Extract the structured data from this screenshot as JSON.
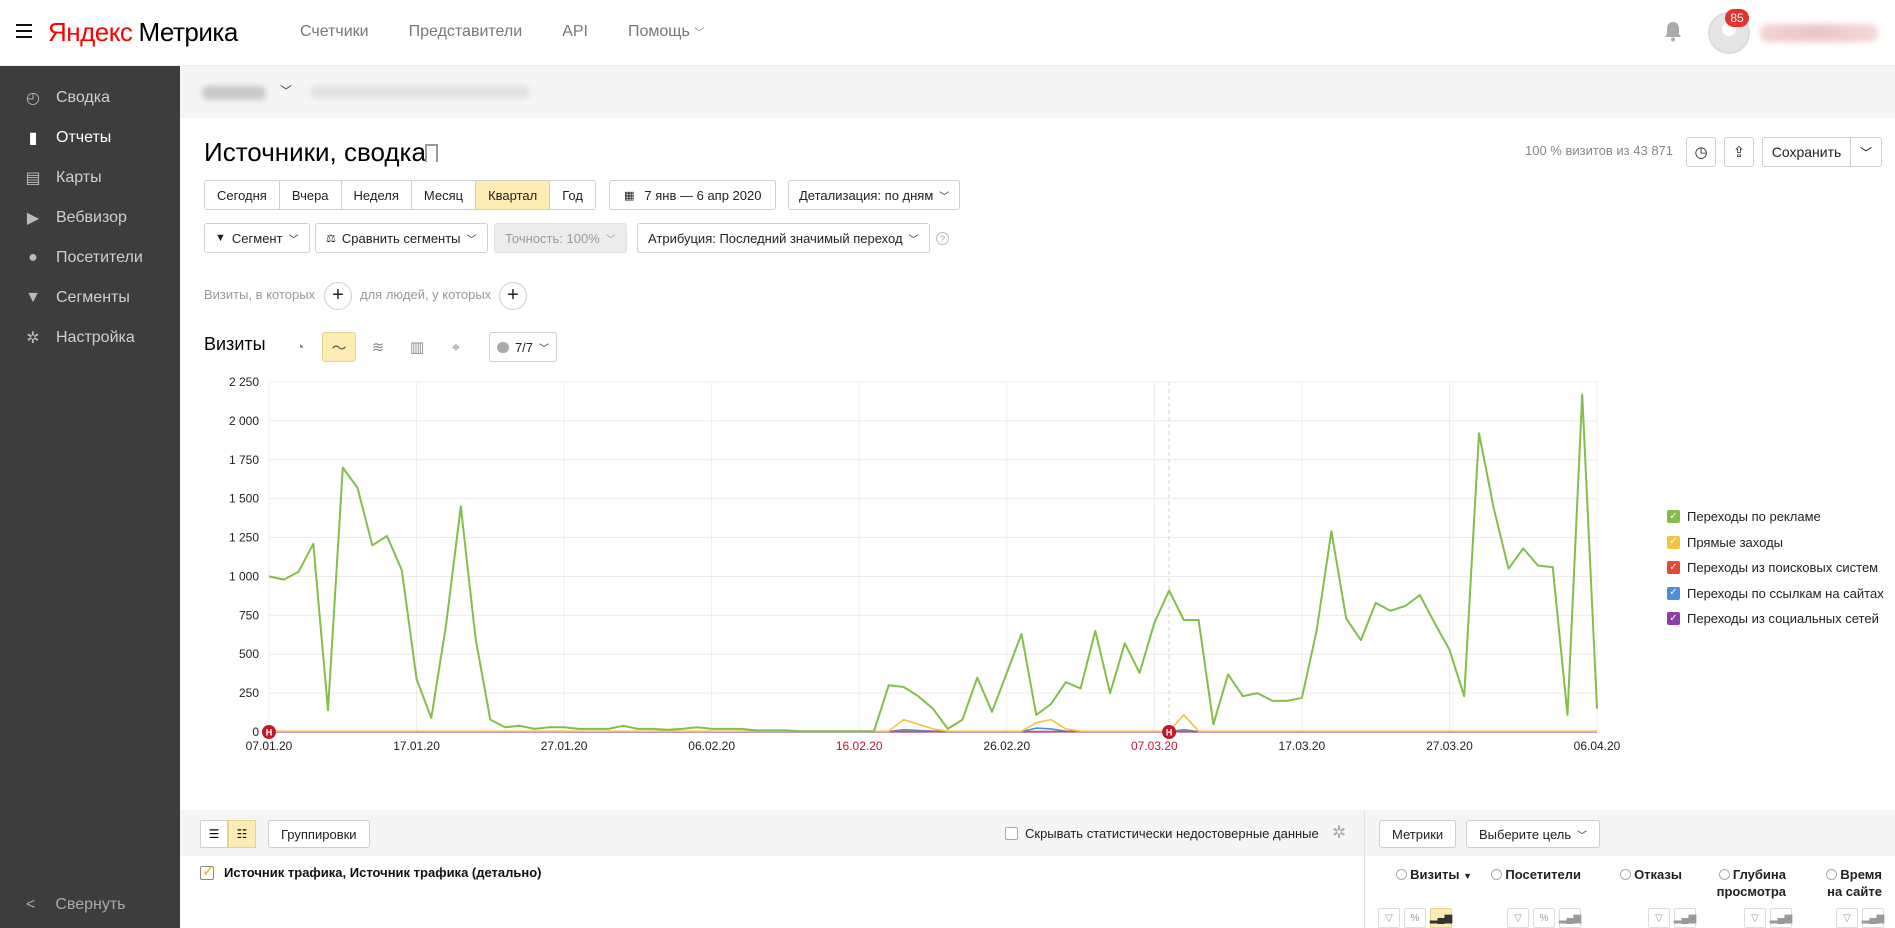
{
  "header": {
    "logo_ya": "Яндекс",
    "logo_metrika": "Метрика",
    "nav": [
      "Счетчики",
      "Представители",
      "API",
      "Помощь"
    ],
    "notifications_count": "85"
  },
  "sidebar": {
    "items": [
      {
        "label": "Сводка",
        "icon": "gauge-icon"
      },
      {
        "label": "Отчеты",
        "icon": "bar-chart-icon"
      },
      {
        "label": "Карты",
        "icon": "map-icon"
      },
      {
        "label": "Вебвизор",
        "icon": "play-icon"
      },
      {
        "label": "Посетители",
        "icon": "user-icon"
      },
      {
        "label": "Сегменты",
        "icon": "funnel-icon"
      },
      {
        "label": "Настройка",
        "icon": "gear-icon"
      }
    ],
    "active_index": 1,
    "collapse_label": "Свернуть"
  },
  "report": {
    "title": "Источники, сводка",
    "visits_info": "100 % визитов из 43 871",
    "save_label": "Сохранить",
    "periods": [
      "Сегодня",
      "Вчера",
      "Неделя",
      "Месяц",
      "Квартал",
      "Год"
    ],
    "selected_period": "Квартал",
    "date_range": "7 янв — 6 апр 2020",
    "detail": "Детализация: по дням",
    "segment": "Сегмент",
    "compare": "Сравнить сегменты",
    "accuracy": "Точность: 100%",
    "attribution": "Атрибуция: Последний значимый переход",
    "filter_visits": "Визиты, в которых",
    "filter_people": "для людей, у которых"
  },
  "chart_panel": {
    "title": "Визиты",
    "notes_label": "7/7"
  },
  "chart_data": {
    "type": "line",
    "ylim": [
      0,
      2250
    ],
    "yticks": [
      0,
      250,
      500,
      750,
      1000,
      1250,
      1500,
      1750,
      2000,
      2250
    ],
    "ytick_labels": [
      "0",
      "250",
      "500",
      "750",
      "1 000",
      "1 250",
      "1 500",
      "1 750",
      "2 000",
      "2 250"
    ],
    "x_labels": [
      "07.01.20",
      "17.01.20",
      "27.01.20",
      "06.02.20",
      "16.02.20",
      "26.02.20",
      "07.03.20",
      "17.03.20",
      "27.03.20",
      "06.04.20"
    ],
    "holiday_labels": [
      "16.02.20",
      "07.03.20"
    ],
    "holiday_markers": [
      {
        "day": 0,
        "label": "Н"
      },
      {
        "day": 61,
        "label": "Н"
      }
    ],
    "today_day": 61,
    "days": 91,
    "series": [
      {
        "name": "Переходы по рекламе",
        "color": "#84be4a",
        "values": [
          1000,
          980,
          1030,
          1210,
          140,
          1700,
          1570,
          1200,
          1260,
          1040,
          340,
          90,
          690,
          1450,
          600,
          80,
          30,
          40,
          20,
          30,
          30,
          20,
          20,
          20,
          40,
          20,
          20,
          15,
          20,
          30,
          20,
          20,
          20,
          10,
          10,
          10,
          5,
          5,
          5,
          5,
          5,
          5,
          300,
          290,
          230,
          150,
          20,
          80,
          350,
          130,
          380,
          630,
          110,
          180,
          320,
          280,
          650,
          250,
          570,
          380,
          700,
          910,
          720,
          720,
          50,
          370,
          230,
          250,
          200,
          200,
          220,
          650,
          1290,
          730,
          590,
          830,
          780,
          810,
          880,
          700,
          530,
          230,
          1920,
          1440,
          1050,
          1180,
          1070,
          1060,
          110,
          2170,
          150
        ]
      },
      {
        "name": "Прямые заходы",
        "color": "#f5c540",
        "values": [
          5,
          5,
          5,
          5,
          5,
          5,
          5,
          5,
          5,
          5,
          5,
          5,
          5,
          5,
          5,
          5,
          5,
          5,
          5,
          5,
          5,
          5,
          5,
          5,
          5,
          5,
          5,
          5,
          5,
          5,
          5,
          5,
          5,
          5,
          5,
          5,
          5,
          5,
          5,
          5,
          5,
          5,
          5,
          80,
          50,
          20,
          5,
          5,
          5,
          5,
          5,
          5,
          60,
          80,
          20,
          5,
          5,
          5,
          5,
          5,
          5,
          5,
          110,
          5,
          5,
          5,
          5,
          5,
          5,
          5,
          5,
          5,
          5,
          5,
          5,
          5,
          5,
          5,
          5,
          5,
          5,
          5,
          5,
          5,
          5,
          5,
          5,
          5,
          5,
          5,
          5
        ]
      },
      {
        "name": "Переходы из поисковых систем",
        "color": "#e8463b",
        "values": [
          3,
          3,
          3,
          3,
          3,
          3,
          3,
          3,
          3,
          3,
          3,
          3,
          3,
          3,
          3,
          3,
          3,
          3,
          3,
          3,
          3,
          3,
          3,
          3,
          3,
          3,
          3,
          3,
          3,
          3,
          3,
          3,
          3,
          3,
          3,
          3,
          3,
          3,
          3,
          3,
          3,
          3,
          3,
          3,
          3,
          3,
          3,
          3,
          3,
          3,
          3,
          3,
          3,
          3,
          3,
          3,
          3,
          3,
          3,
          3,
          3,
          3,
          3,
          3,
          3,
          3,
          3,
          3,
          3,
          3,
          3,
          3,
          3,
          3,
          3,
          3,
          3,
          3,
          3,
          3,
          3,
          3,
          3,
          3,
          3,
          3,
          3,
          3,
          3,
          3,
          3
        ]
      },
      {
        "name": "Переходы по ссылкам на сайтах",
        "color": "#4a90d9",
        "values": [
          2,
          2,
          2,
          2,
          2,
          2,
          2,
          2,
          2,
          2,
          2,
          2,
          2,
          2,
          2,
          2,
          2,
          2,
          2,
          2,
          2,
          2,
          2,
          2,
          2,
          2,
          2,
          2,
          2,
          2,
          2,
          2,
          2,
          2,
          2,
          2,
          2,
          2,
          2,
          2,
          2,
          2,
          2,
          15,
          10,
          5,
          2,
          2,
          2,
          2,
          2,
          2,
          25,
          20,
          5,
          2,
          2,
          2,
          2,
          2,
          2,
          2,
          15,
          2,
          2,
          2,
          2,
          2,
          2,
          2,
          2,
          2,
          2,
          2,
          2,
          2,
          2,
          2,
          2,
          2,
          2,
          2,
          2,
          2,
          2,
          2,
          2,
          2,
          2,
          2,
          2
        ]
      },
      {
        "name": "Переходы из социальных сетей",
        "color": "#8e3fa5",
        "values": [
          1,
          1,
          1,
          1,
          1,
          1,
          1,
          1,
          1,
          1,
          1,
          1,
          1,
          1,
          1,
          1,
          1,
          1,
          1,
          1,
          1,
          1,
          1,
          1,
          1,
          1,
          1,
          1,
          1,
          1,
          1,
          1,
          1,
          1,
          1,
          1,
          1,
          1,
          1,
          1,
          1,
          1,
          1,
          1,
          1,
          1,
          1,
          1,
          1,
          1,
          1,
          1,
          1,
          1,
          1,
          1,
          1,
          1,
          1,
          1,
          1,
          1,
          1,
          1,
          1,
          1,
          1,
          1,
          1,
          1,
          1,
          1,
          1,
          1,
          1,
          1,
          1,
          1,
          1,
          1,
          1,
          1,
          1,
          1,
          1,
          1,
          1,
          1,
          1,
          1,
          1
        ]
      }
    ],
    "grid": true,
    "legend_position": "right"
  },
  "table": {
    "groupings_label": "Группировки",
    "hide_unreliable": "Скрывать статистически недостоверные данные",
    "metrics_label": "Метрики",
    "goal_label": "Выберите цель",
    "dimension": "Источник трафика, Источник трафика (детально)",
    "metrics": [
      {
        "line1": "Визиты",
        "line2": ""
      },
      {
        "line1": "Посетители",
        "line2": ""
      },
      {
        "line1": "Отказы",
        "line2": ""
      },
      {
        "line1": "Глубина",
        "line2": "просмотра"
      },
      {
        "line1": "Время",
        "line2": "на сайте"
      }
    ]
  }
}
